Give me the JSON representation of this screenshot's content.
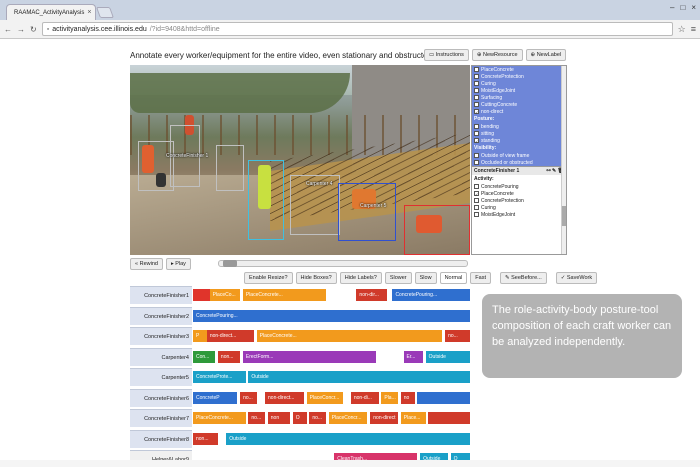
{
  "browser": {
    "tab_title": "RAAMAC_ActivityAnalysis",
    "url_host": "activityanalysis.cee.illinois.edu",
    "url_path": "/?id=9408&httd=offline"
  },
  "page": {
    "instruction": "Annotate every worker/equipment for the entire video, even stationary and obstructed.",
    "buttons": {
      "instructions": "Instructions",
      "new_resource": "NewResource",
      "new_label": "NewLabel"
    }
  },
  "video": {
    "labels": [
      "ConcreteFinisher 1",
      "Carpenter 4",
      "Carpenter 5"
    ]
  },
  "panel": {
    "options_top": [
      {
        "label": "PlaceConcrete",
        "checked": false
      },
      {
        "label": "ConcreteProtection",
        "checked": false
      },
      {
        "label": "Curing",
        "checked": false
      },
      {
        "label": "MoistEdgeJoint",
        "checked": false
      },
      {
        "label": "Surfacing",
        "checked": false
      },
      {
        "label": "CuttingConcrete",
        "checked": false
      },
      {
        "label": "non-direct",
        "checked": true
      }
    ],
    "posture_header": "Posture:",
    "posture_options": [
      {
        "label": "bending",
        "checked": false
      },
      {
        "label": "sitting",
        "checked": false
      },
      {
        "label": "standing",
        "checked": true
      }
    ],
    "visibility_header": "Visibility:",
    "visibility_options": [
      {
        "label": "Outside of view frame",
        "checked": false
      },
      {
        "label": "Occluded or obstructed",
        "checked": false
      }
    ],
    "resource_title": "ConcreteFinisher 1",
    "activity_header": "Activity:",
    "activity_options": [
      {
        "label": "ConcretePouring",
        "checked": false
      },
      {
        "label": "PlaceConcrete",
        "checked": true
      },
      {
        "label": "ConcreteProtection",
        "checked": false
      },
      {
        "label": "Curing",
        "checked": false
      },
      {
        "label": "MoistEdgeJoint",
        "checked": false
      }
    ]
  },
  "controls": {
    "rewind": "Rewind",
    "play": "Play",
    "enable_resize": "Enable Resize?",
    "hide_boxes": "Hide Boxes?",
    "hide_labels": "Hide Labels?",
    "slower": "Slower",
    "slow": "Slow",
    "normal": "Normal",
    "fast": "Fast",
    "see_before": "SeeBefore...",
    "save_work": "SaveWork"
  },
  "timeline": [
    {
      "name": "ConcreteFinisher1",
      "segments": [
        {
          "x": 0.0,
          "w": 0.06,
          "c": "#e0342b",
          "t": ""
        },
        {
          "x": 0.06,
          "w": 0.11,
          "c": "#f29a1d",
          "t": "PlaceCo..."
        },
        {
          "x": 0.18,
          "w": 0.3,
          "c": "#f29a1d",
          "t": "PlaceConcrete..."
        },
        {
          "x": 0.59,
          "w": 0.11,
          "c": "#d03a2a",
          "t": "non-dir..."
        },
        {
          "x": 0.72,
          "w": 0.28,
          "c": "#2f6fcf",
          "t": "ConcretePouring..."
        }
      ]
    },
    {
      "name": "ConcreteFinisher2",
      "segments": [
        {
          "x": 0.0,
          "w": 1.0,
          "c": "#2f6fcf",
          "t": "ConcretePouring..."
        }
      ]
    },
    {
      "name": "ConcreteFinisher3",
      "segments": [
        {
          "x": 0.0,
          "w": 0.05,
          "c": "#f29a1d",
          "t": "P"
        },
        {
          "x": 0.05,
          "w": 0.17,
          "c": "#d03a2a",
          "t": "non-direct..."
        },
        {
          "x": 0.23,
          "w": 0.67,
          "c": "#f29a1d",
          "t": "PlaceConcrete..."
        },
        {
          "x": 0.91,
          "w": 0.09,
          "c": "#d03a2a",
          "t": "no..."
        }
      ]
    },
    {
      "name": "Carpenter4",
      "segments": [
        {
          "x": 0.0,
          "w": 0.08,
          "c": "#2e9a3a",
          "t": "Con..."
        },
        {
          "x": 0.09,
          "w": 0.08,
          "c": "#d03a2a",
          "t": "non..."
        },
        {
          "x": 0.18,
          "w": 0.48,
          "c": "#9a3ab8",
          "t": "ErectForm..."
        },
        {
          "x": 0.76,
          "w": 0.07,
          "c": "#9a3ab8",
          "t": "Er..."
        },
        {
          "x": 0.84,
          "w": 0.16,
          "c": "#1aa0c8",
          "t": "Outside"
        }
      ]
    },
    {
      "name": "Carpenter5",
      "segments": [
        {
          "x": 0.0,
          "w": 0.19,
          "c": "#1aa0c8",
          "t": "ConcreteProte..."
        },
        {
          "x": 0.2,
          "w": 0.8,
          "c": "#1aa0c8",
          "t": "Outside"
        }
      ]
    },
    {
      "name": "ConcreteFinisher6",
      "segments": [
        {
          "x": 0.0,
          "w": 0.16,
          "c": "#2f6fcf",
          "t": "ConcreteP"
        },
        {
          "x": 0.17,
          "w": 0.06,
          "c": "#d03a2a",
          "t": "no..."
        },
        {
          "x": 0.26,
          "w": 0.14,
          "c": "#d03a2a",
          "t": "non-direct..."
        },
        {
          "x": 0.41,
          "w": 0.13,
          "c": "#f29a1d",
          "t": "PlaceConcr..."
        },
        {
          "x": 0.57,
          "w": 0.1,
          "c": "#d03a2a",
          "t": "non-di..."
        },
        {
          "x": 0.68,
          "w": 0.06,
          "c": "#f29a1d",
          "t": "Pla..."
        },
        {
          "x": 0.75,
          "w": 0.05,
          "c": "#d03a2a",
          "t": "no"
        },
        {
          "x": 0.81,
          "w": 0.19,
          "c": "#2f6fcf",
          "t": ""
        }
      ]
    },
    {
      "name": "ConcreteFinisher7",
      "segments": [
        {
          "x": 0.0,
          "w": 0.19,
          "c": "#f29a1d",
          "t": "PlaceConcrete..."
        },
        {
          "x": 0.2,
          "w": 0.06,
          "c": "#d03a2a",
          "t": "no..."
        },
        {
          "x": 0.27,
          "w": 0.08,
          "c": "#d03a2a",
          "t": "non"
        },
        {
          "x": 0.36,
          "w": 0.05,
          "c": "#d03a2a",
          "t": "O"
        },
        {
          "x": 0.42,
          "w": 0.06,
          "c": "#d03a2a",
          "t": "no..."
        },
        {
          "x": 0.49,
          "w": 0.14,
          "c": "#f29a1d",
          "t": "PlaceConcr..."
        },
        {
          "x": 0.64,
          "w": 0.1,
          "c": "#d03a2a",
          "t": "non-direct"
        },
        {
          "x": 0.75,
          "w": 0.09,
          "c": "#f29a1d",
          "t": "Place..."
        },
        {
          "x": 0.85,
          "w": 0.15,
          "c": "#d03a2a",
          "t": ""
        }
      ]
    },
    {
      "name": "ConcreteFinisher8",
      "segments": [
        {
          "x": 0.0,
          "w": 0.09,
          "c": "#d03a2a",
          "t": "non..."
        },
        {
          "x": 0.12,
          "w": 0.88,
          "c": "#1aa0c8",
          "t": "Outside"
        }
      ]
    },
    {
      "name": "Helper&Labor9",
      "segments": [
        {
          "x": 0.51,
          "w": 0.3,
          "c": "#d8346a",
          "t": "CleanTrash..."
        },
        {
          "x": 0.82,
          "w": 0.1,
          "c": "#1aa0c8",
          "t": "Outside"
        },
        {
          "x": 0.93,
          "w": 0.07,
          "c": "#1aa0c8",
          "t": "O"
        }
      ]
    }
  ],
  "caption": "The role-activity-body posture-tool composition of each craft worker can be analyzed independently."
}
